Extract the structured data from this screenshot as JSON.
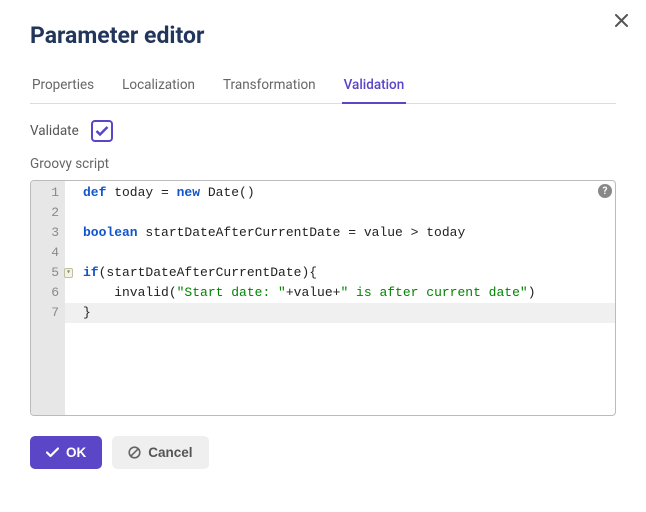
{
  "dialog": {
    "title": "Parameter editor"
  },
  "tabs": {
    "items": [
      {
        "label": "Properties"
      },
      {
        "label": "Localization"
      },
      {
        "label": "Transformation"
      },
      {
        "label": "Validation"
      }
    ],
    "activeIndex": 3
  },
  "validate": {
    "label": "Validate",
    "checked": true
  },
  "script": {
    "label": "Groovy script",
    "lines": [
      {
        "n": 1,
        "segments": [
          {
            "cls": "kw",
            "t": "def"
          },
          {
            "cls": "pln",
            "t": " today = "
          },
          {
            "cls": "kw",
            "t": "new"
          },
          {
            "cls": "pln",
            "t": " Date()"
          }
        ]
      },
      {
        "n": 2,
        "segments": [
          {
            "cls": "pln",
            "t": ""
          }
        ]
      },
      {
        "n": 3,
        "segments": [
          {
            "cls": "typ",
            "t": "boolean"
          },
          {
            "cls": "pln",
            "t": " startDateAfterCurrentDate = value > today"
          }
        ]
      },
      {
        "n": 4,
        "segments": [
          {
            "cls": "pln",
            "t": ""
          }
        ]
      },
      {
        "n": 5,
        "fold": true,
        "segments": [
          {
            "cls": "kw",
            "t": "if"
          },
          {
            "cls": "pln",
            "t": "(startDateAfterCurrentDate){"
          }
        ]
      },
      {
        "n": 6,
        "segments": [
          {
            "cls": "pln",
            "t": "    invalid("
          },
          {
            "cls": "str",
            "t": "\"Start date: \""
          },
          {
            "cls": "pln",
            "t": "+value+"
          },
          {
            "cls": "str",
            "t": "\" is after current date\""
          },
          {
            "cls": "pln",
            "t": ")"
          }
        ]
      },
      {
        "n": 7,
        "highlight": true,
        "segments": [
          {
            "cls": "pln",
            "t": "}"
          }
        ]
      }
    ]
  },
  "buttons": {
    "ok": "OK",
    "cancel": "Cancel"
  },
  "help": {
    "glyph": "?"
  }
}
